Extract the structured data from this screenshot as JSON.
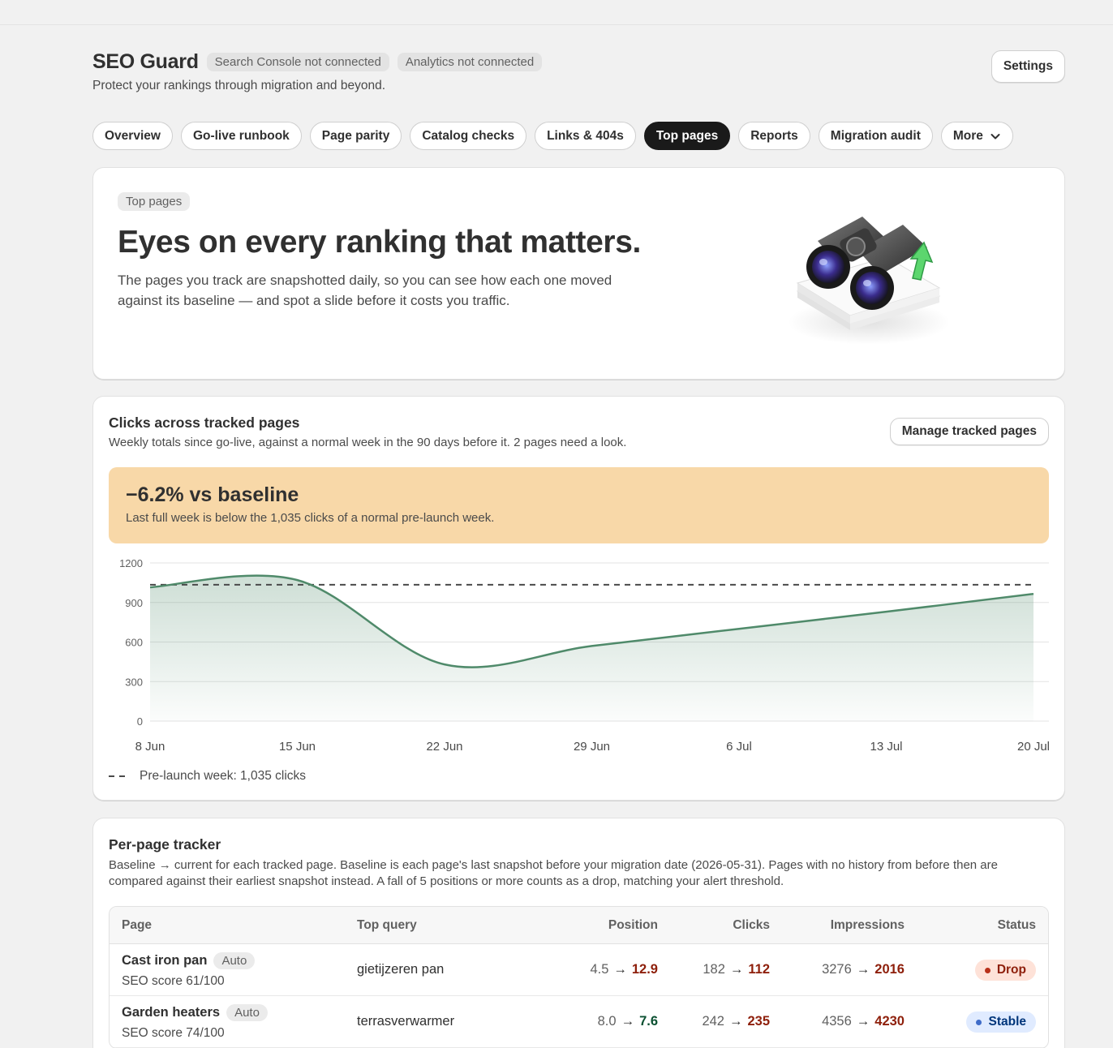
{
  "app": {
    "title": "SEO Guard",
    "badges": [
      "Search Console not connected",
      "Analytics not connected"
    ],
    "subtitle": "Protect your rankings through migration and beyond.",
    "settings_label": "Settings"
  },
  "tabs": [
    {
      "label": "Overview",
      "active": false
    },
    {
      "label": "Go-live runbook",
      "active": false
    },
    {
      "label": "Page parity",
      "active": false
    },
    {
      "label": "Catalog checks",
      "active": false
    },
    {
      "label": "Links & 404s",
      "active": false
    },
    {
      "label": "Top pages",
      "active": true
    },
    {
      "label": "Reports",
      "active": false
    },
    {
      "label": "Migration audit",
      "active": false
    },
    {
      "label": "More",
      "active": false,
      "icon": "chevron-down-icon"
    }
  ],
  "hero": {
    "badge": "Top pages",
    "title": "Eyes on every ranking that matters.",
    "text": "The pages you track are snapshotted daily, so you can see how each one moved against its baseline — and spot a slide before it costs you traffic.",
    "illustration": "binoculars-icon"
  },
  "clicks": {
    "title": "Clicks across tracked pages",
    "subtitle": "Weekly totals since go-live, against a normal week in the 90 days before it. 2 pages need a look.",
    "manage_label": "Manage tracked pages",
    "banner_title": "−6.2% vs baseline",
    "banner_text": "Last full week is below the 1,035 clicks of a normal pre-launch week.",
    "banner_color": "#f8d8a8",
    "legend_label": "Pre-launch week: 1,035 clicks"
  },
  "chart_data": {
    "type": "area",
    "x": [
      "8 Jun",
      "15 Jun",
      "22 Jun",
      "29 Jun",
      "6 Jul",
      "13 Jul",
      "20 Jul"
    ],
    "values": [
      1015,
      1070,
      430,
      570,
      700,
      830,
      965
    ],
    "baseline": 1035,
    "ylim": [
      0,
      1200
    ],
    "yticks": [
      0,
      300,
      600,
      900,
      1200
    ],
    "grid": true,
    "line_color": "#4f8a6a",
    "baseline_color": "#4a4a4a"
  },
  "tracker": {
    "title": "Per-page tracker",
    "subtitle": "Baseline → current for each tracked page. Baseline is each page's last snapshot before your migration date (2026-05-31). Pages with no history from before then are compared against their earliest snapshot instead. A fall of 5 positions or more counts as a drop, matching your alert threshold.",
    "columns": [
      "Page",
      "Top query",
      "Position",
      "Clicks",
      "Impressions",
      "Status"
    ],
    "arrow": "→",
    "rows": [
      {
        "page": "Cast iron pan",
        "tag": "Auto",
        "score": "SEO score 61/100",
        "query": "gietijzeren pan",
        "position": {
          "base": "4.5",
          "cur": "12.9",
          "trend": "bad"
        },
        "clicks": {
          "base": "182",
          "cur": "112",
          "trend": "bad"
        },
        "impressions": {
          "base": "3276",
          "cur": "2016",
          "trend": "bad"
        },
        "status": "Drop"
      },
      {
        "page": "Garden heaters",
        "tag": "Auto",
        "score": "SEO score 74/100",
        "query": "terrasverwarmer",
        "position": {
          "base": "8.0",
          "cur": "7.6",
          "trend": "good"
        },
        "clicks": {
          "base": "242",
          "cur": "235",
          "trend": "bad"
        },
        "impressions": {
          "base": "4356",
          "cur": "4230",
          "trend": "bad"
        },
        "status": "Stable"
      }
    ]
  }
}
